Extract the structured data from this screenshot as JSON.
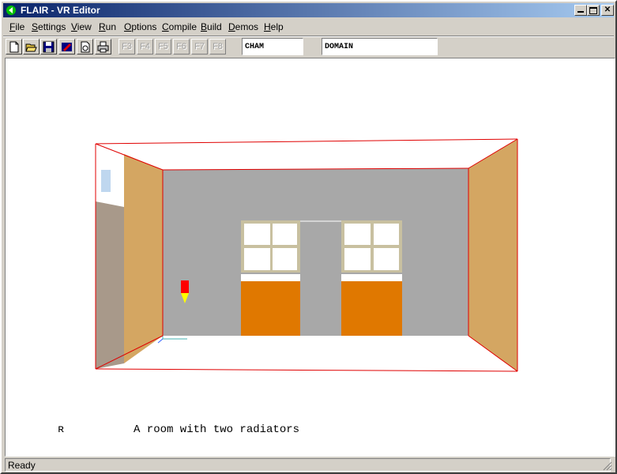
{
  "window": {
    "title": "FLAIR - VR Editor"
  },
  "menu": [
    {
      "label": "File",
      "key": "F",
      "rest": "ile"
    },
    {
      "label": "Settings",
      "key": "S",
      "rest": "ettings"
    },
    {
      "label": "View",
      "key": "V",
      "rest": "iew"
    },
    {
      "label": "Run",
      "key": "R",
      "rest": "un"
    },
    {
      "label": "Options",
      "key": "O",
      "rest": "ptions"
    },
    {
      "label": "Compile",
      "key": "C",
      "rest": "ompile"
    },
    {
      "label": "Build",
      "key": "B",
      "rest": "uild"
    },
    {
      "label": "Demos",
      "key": "D",
      "rest": "emos"
    },
    {
      "label": "Help",
      "key": "H",
      "rest": "elp"
    }
  ],
  "toolbar": {
    "tools": [
      "new-file-icon",
      "open-folder-icon",
      "save-disk-icon",
      "erase-icon",
      "refresh-icon",
      "print-icon"
    ],
    "function_keys": [
      "F3",
      "F4",
      "F5",
      "F6",
      "F7",
      "F8"
    ],
    "field_left": "CHAM",
    "field_right": "DOMAIN"
  },
  "scene": {
    "caption_mark": "ʀ",
    "caption": "A room with two radiators",
    "colors": {
      "back_wall": "#a8a8a8",
      "side_wall": "#d4a662",
      "left_inner_wall": "#a8998a",
      "radiator": "#e07800",
      "window_frame": "#c8c0a0",
      "edge": "#e00000",
      "marker": "#ff0000",
      "marker_tip": "#ffff00"
    }
  },
  "status": {
    "text": "Ready"
  }
}
